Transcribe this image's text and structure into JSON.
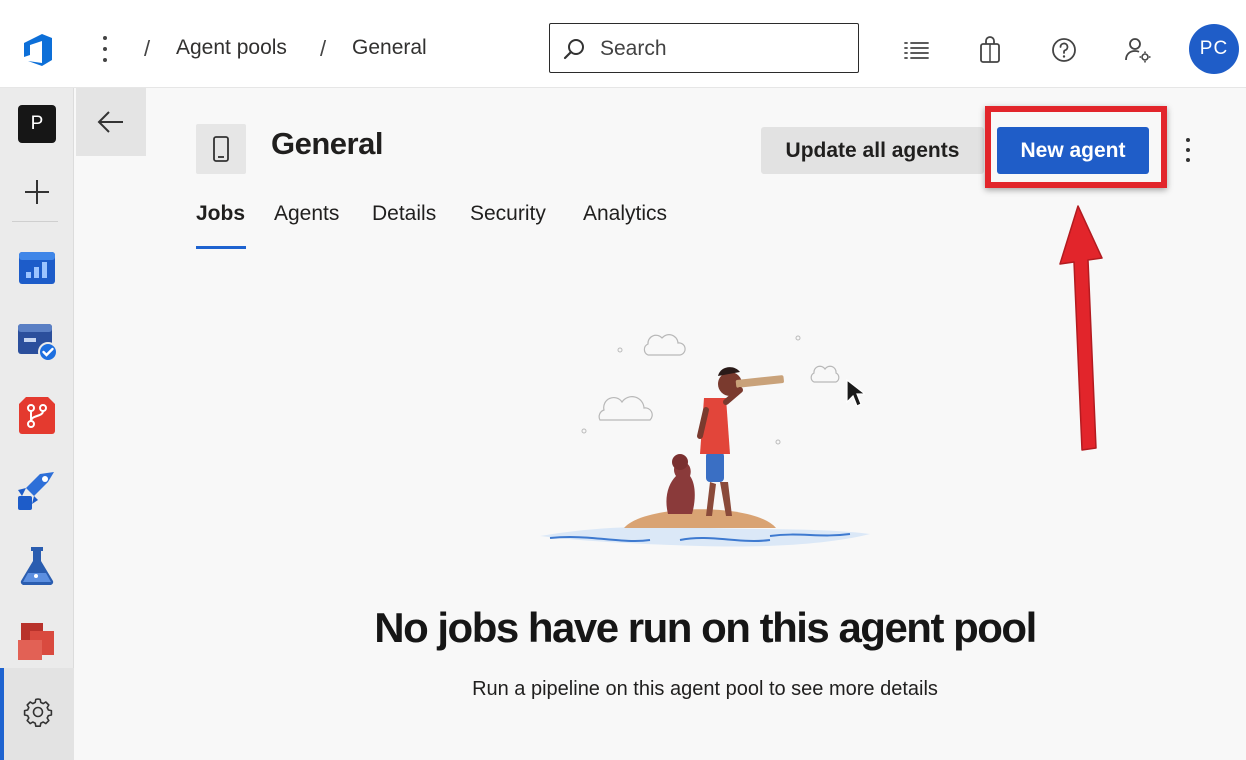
{
  "header": {
    "breadcrumb": [
      "Agent pools",
      "General"
    ],
    "search_placeholder": "Search",
    "avatar_initials": "PC"
  },
  "rail": {
    "project_initial": "P"
  },
  "page": {
    "title": "General",
    "actions": {
      "update_label": "Update all agents",
      "new_label": "New agent"
    },
    "tabs": [
      {
        "label": "Jobs",
        "active": true
      },
      {
        "label": "Agents",
        "active": false
      },
      {
        "label": "Details",
        "active": false
      },
      {
        "label": "Security",
        "active": false
      },
      {
        "label": "Analytics",
        "active": false
      }
    ]
  },
  "empty_state": {
    "title": "No jobs have run on this agent pool",
    "subtitle": "Run a pipeline on this agent pool to see more details"
  },
  "colors": {
    "accent": "#1f5dc8",
    "annotation": "#e2252b"
  }
}
